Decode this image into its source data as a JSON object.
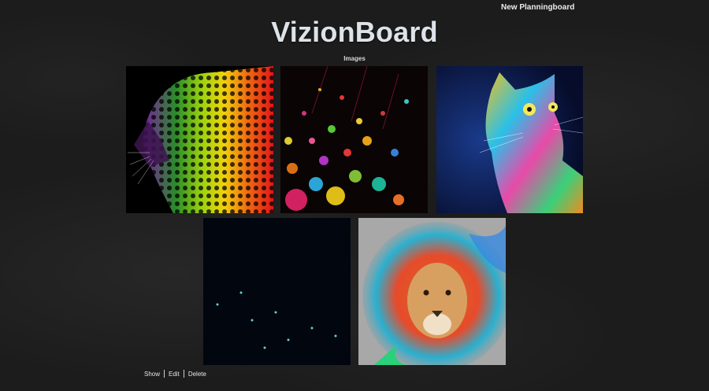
{
  "nav": {
    "new_planningboard": "New Planningboard"
  },
  "header": {
    "title": "VizionBoard",
    "subtitle": "Images"
  },
  "images": [
    {
      "subject": "rainbow leopard"
    },
    {
      "subject": "colorful paint splash"
    },
    {
      "subject": "psychedelic cat"
    },
    {
      "subject": "blue glitter rain"
    },
    {
      "subject": "colorful lion"
    }
  ],
  "actions": {
    "show": "Show",
    "edit": "Edit",
    "delete": "Delete"
  }
}
